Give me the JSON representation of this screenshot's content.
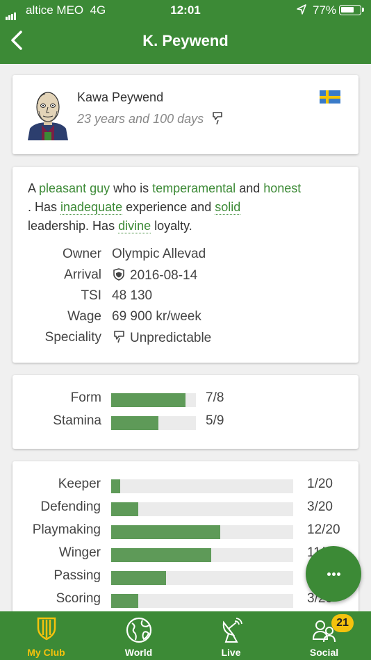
{
  "status_bar": {
    "carrier": "altice MEO",
    "network": "4G",
    "time": "12:01",
    "battery": "77%",
    "battery_level": 0.77
  },
  "header": {
    "title": "K. Peywend"
  },
  "player": {
    "name": "Kawa Peywend",
    "age": "23 years and 100 days",
    "flag_icon": "sweden-flag-icon"
  },
  "description": {
    "p1": "A ",
    "t1": "pleasant guy",
    "p2": " who is ",
    "t2": "temperamental",
    "p3": " and ",
    "t3": "honest",
    "p4": " . Has ",
    "t4": "inadequate",
    "p5": " experience and ",
    "t5": "solid",
    "p6": " leadership. Has ",
    "t6": "divine",
    "p7": " loyalty."
  },
  "info": {
    "owner_label": "Owner",
    "owner": "Olympic Allevad",
    "arrival_label": "Arrival",
    "arrival": "2016-08-14",
    "tsi_label": "TSI",
    "tsi": "48 130",
    "wage_label": "Wage",
    "wage": "69 900 kr/week",
    "speciality_label": "Speciality",
    "speciality": "Unpredictable"
  },
  "condition": [
    {
      "label": "Form",
      "value": 7,
      "max": 8,
      "display": "7/8"
    },
    {
      "label": "Stamina",
      "value": 5,
      "max": 9,
      "display": "5/9"
    }
  ],
  "skills": [
    {
      "label": "Keeper",
      "value": 1,
      "max": 20,
      "display": "1/20"
    },
    {
      "label": "Defending",
      "value": 3,
      "max": 20,
      "display": "3/20"
    },
    {
      "label": "Playmaking",
      "value": 12,
      "max": 20,
      "display": "12/20"
    },
    {
      "label": "Winger",
      "value": 11,
      "max": 20,
      "display": "11/20"
    },
    {
      "label": "Passing",
      "value": 6,
      "max": 20,
      "display": "6/20"
    },
    {
      "label": "Scoring",
      "value": 3,
      "max": 20,
      "display": "3/20"
    }
  ],
  "nav": {
    "my_club": "My Club",
    "world": "World",
    "live": "Live",
    "social": "Social",
    "social_badge": "21",
    "active_color": "#f4c20d"
  },
  "colors": {
    "primary": "#3c8a36",
    "bar": "#5e9a58",
    "track": "#ebebeb"
  }
}
